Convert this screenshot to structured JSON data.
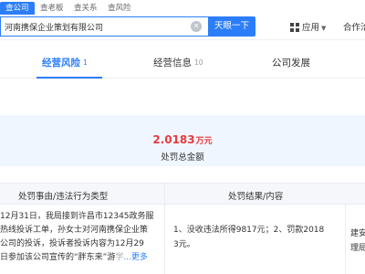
{
  "tabs": [
    {
      "label": "查公司"
    },
    {
      "label": "查老板"
    },
    {
      "label": "查关系"
    },
    {
      "label": "查风险"
    }
  ],
  "search": {
    "value": "河南携保企业策划有限公司",
    "button_label": "天眼一下"
  },
  "header": {
    "apps_label": "应用",
    "cooperate_label": "合作洽"
  },
  "section_tabs": [
    {
      "label": "经营风险",
      "count": "1"
    },
    {
      "label": "经营信息",
      "count": "10"
    },
    {
      "label": "公司发展",
      "count": ""
    }
  ],
  "summary": {
    "amount": "2.0183",
    "unit": "万元",
    "label": "处罚总金额"
  },
  "table": {
    "headers": [
      "处罚事由/违法行为类型",
      "处罚结果/内容"
    ],
    "rows": [
      {
        "reason_lines": [
          "12月31日，我局接到许昌市12345政务服",
          "热线投诉工单，孙女士对河南携保企业策",
          "公司的投诉，投诉者投诉内容为12月29",
          "日参加该公司宣传的“胖东来”游"
        ],
        "reason_fade": "学",
        "more_label": "...更多",
        "result_lines": [
          "1、没收违法所得9817元；2、罚款2018",
          "3元。"
        ],
        "extra_lines": [
          "建安",
          "理局"
        ]
      }
    ]
  },
  "colors": {
    "accent": "#2c7ef8",
    "amount": "#e63c3c",
    "summary_bg": "#f0f6ff"
  }
}
